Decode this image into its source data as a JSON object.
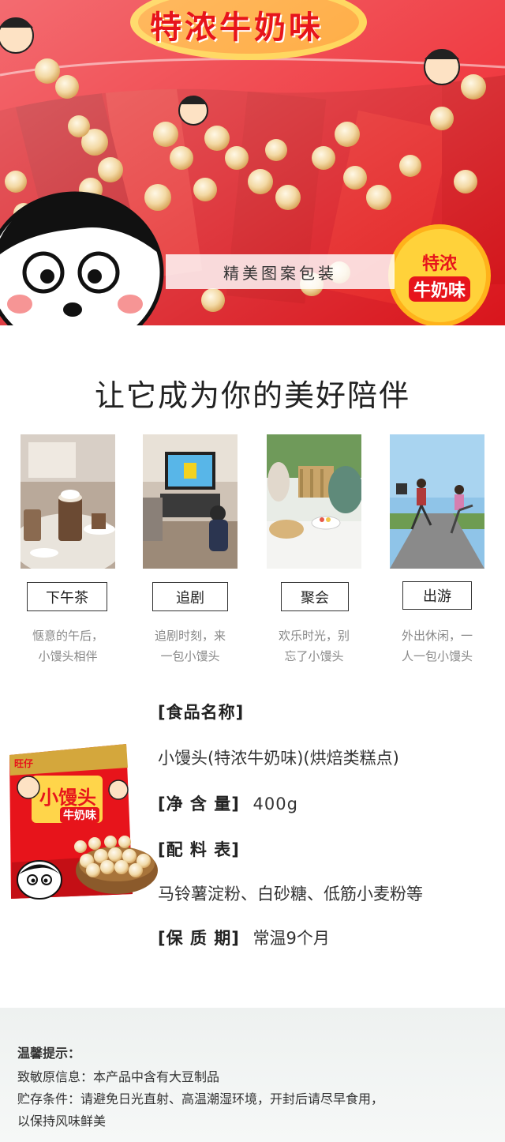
{
  "hero": {
    "brand_text": "特浓牛奶味",
    "caption": "精美图案包装",
    "badge_line1": "特浓",
    "badge_line2": "牛奶味",
    "colors": {
      "package_red": "#e7141b",
      "badge_yellow": "#ffd23a"
    }
  },
  "headline": "让它成为你的美好陪伴",
  "scenes": [
    {
      "tag": "下午茶",
      "desc_line1": "惬意的午后，",
      "desc_line2": "小馒头相伴",
      "photo": "afternoon-tea-photo"
    },
    {
      "tag": "追剧",
      "desc_line1": "追剧时刻，来",
      "desc_line2": "一包小馒头",
      "photo": "watching-tv-photo"
    },
    {
      "tag": "聚会",
      "desc_line1": "欢乐时光，别",
      "desc_line2": "忘了小馒头",
      "photo": "party-photo"
    },
    {
      "tag": "出游",
      "desc_line1": "外出休闲，一",
      "desc_line2": "人一包小馒头",
      "photo": "travel-photo"
    }
  ],
  "product": {
    "image_label_top": "旺仔",
    "image_label_name": "小馒头",
    "image_label_flavor": "牛奶味",
    "name_label": "[食品名称]",
    "name_value": "小馒头(特浓牛奶味)(烘焙类糕点)",
    "weight_label": "[净 含 量]",
    "weight_value": "400g",
    "ingredients_label": "[配 料 表]",
    "ingredients_value": "马铃薯淀粉、白砂糖、低筋小麦粉等",
    "shelf_label": "[保 质 期]",
    "shelf_value": "常温9个月"
  },
  "notice": {
    "title": "温馨提示：",
    "allergen": "致敏原信息：本产品中含有大豆制品",
    "storage_line1": "贮存条件：请避免日光直射、高温潮湿环境，开封后请尽早食用，",
    "storage_line2": "以保持风味鲜美"
  }
}
